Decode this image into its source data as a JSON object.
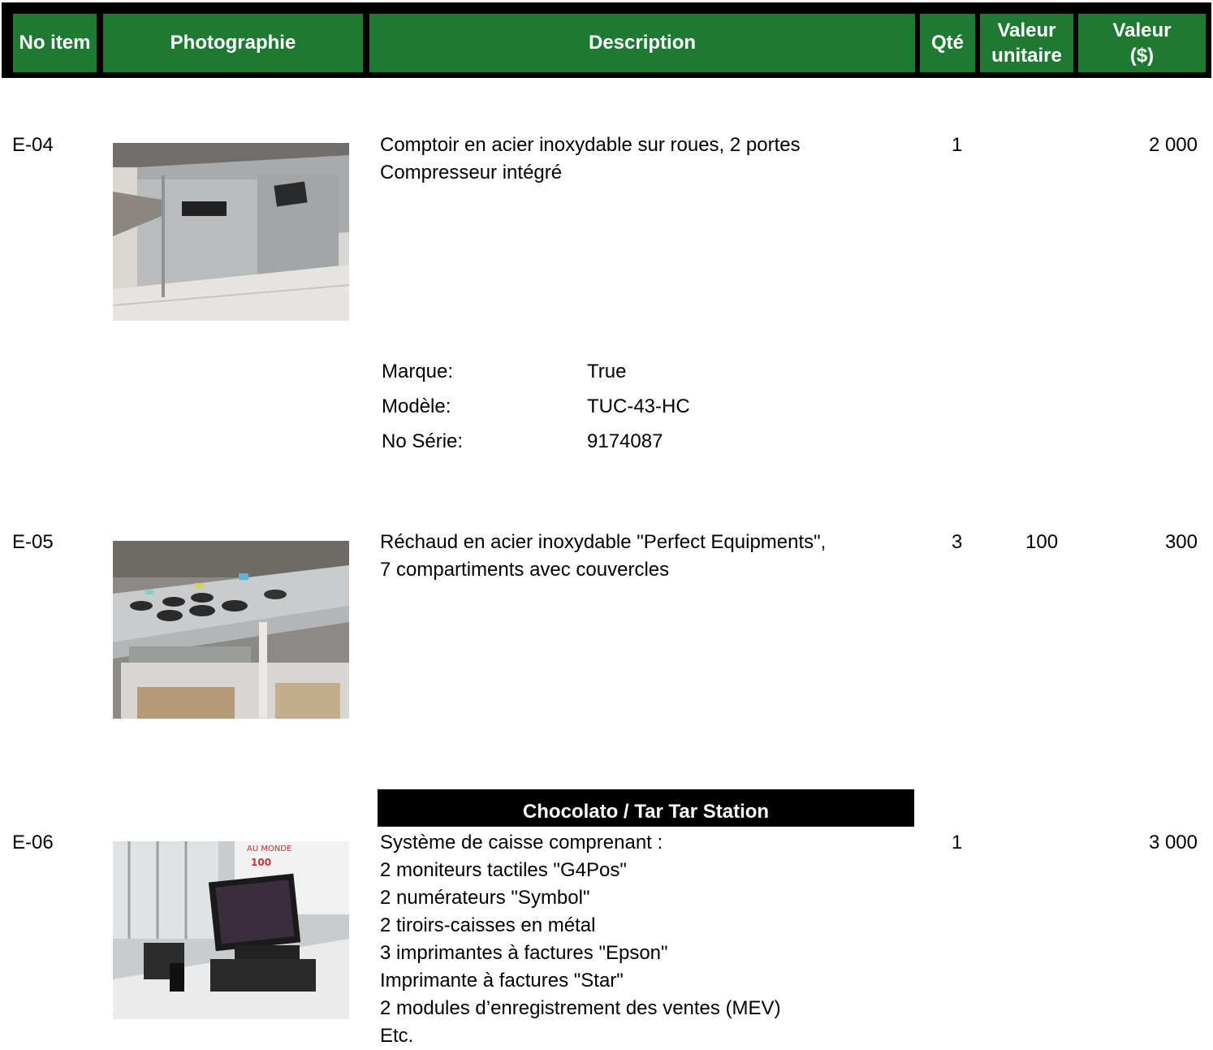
{
  "header": {
    "no_item": "No item",
    "photo": "Photographie",
    "description": "Description",
    "qty": "Qté",
    "unit_value_1": "Valeur",
    "unit_value_2": "unitaire",
    "value_1": "Valeur",
    "value_2": "($)"
  },
  "colors": {
    "header_green": "#1e7a32",
    "frame": "#000000"
  },
  "items": [
    {
      "no": "E-04",
      "desc_lines": [
        "Comptoir en acier inoxydable sur roues, 2 portes",
        "Compresseur intégré"
      ],
      "qty": "1",
      "unit_value": "",
      "value": "2 000",
      "photo_icon": "stainless-counter-photo",
      "specs": [
        {
          "label": "Marque:",
          "value": "True"
        },
        {
          "label": "Modèle:",
          "value": "TUC-43-HC"
        },
        {
          "label": "No Série:",
          "value": "9174087"
        }
      ]
    },
    {
      "no": "E-05",
      "desc_lines": [
        "Réchaud en acier inoxydable \"Perfect Equipments\",",
        "7 compartiments avec couvercles"
      ],
      "qty": "3",
      "unit_value": "100",
      "value": "300",
      "photo_icon": "food-warmer-photo"
    },
    {
      "section": "Chocolato / Tar Tar Station",
      "no": "E-06",
      "desc_lines": [
        "Système de caisse comprenant :",
        "2 moniteurs tactiles \"G4Pos\"",
        "2 numérateurs \"Symbol\"",
        "2 tiroirs-caisses en métal",
        "3 imprimantes à factures \"Epson\"",
        "Imprimante à factures \"Star\"",
        "2 modules d’enregistrement des ventes (MEV)",
        "Etc."
      ],
      "qty": "1",
      "unit_value": "",
      "value": "3 000",
      "photo_icon": "pos-system-photo",
      "photo_text_1": "AU MONDE",
      "photo_text_2": "100"
    }
  ]
}
